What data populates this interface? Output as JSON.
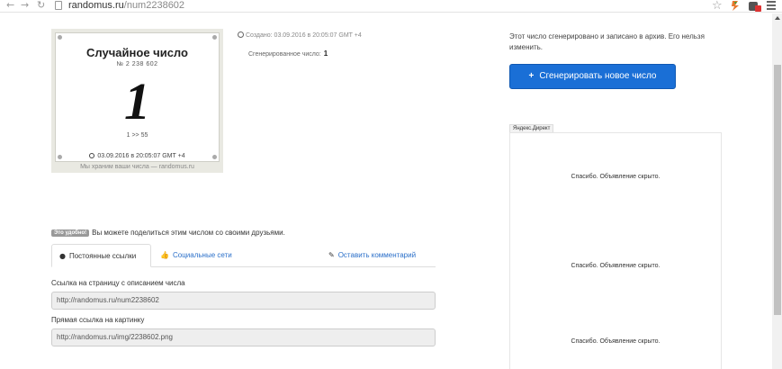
{
  "browser": {
    "url_host": "randomus.ru",
    "url_path": "/num2238602"
  },
  "card": {
    "title": "Случайное число",
    "number_line": "№ 2 238 602",
    "value": "1",
    "range": "1 >> 55",
    "date": "03.09.2016 в 20:05:07 GMT +4",
    "footer": "Мы храним ваши числа — randomus.ru"
  },
  "meta": {
    "created": "Создано: 03.09.2016 в 20:05:07 GMT +4",
    "generated_label": "Сгенерированное число:",
    "generated_value": "1"
  },
  "right": {
    "archive_note": "Этот число сгенерировано и записано в архив. Его нельзя изменить.",
    "generate_button": "Сгенерировать новое число",
    "ad_label": "Яндекс.Директ",
    "ad_texts": [
      "Спасибо. Объявление скрыто.",
      "Спасибо. Объявление скрыто.",
      "Спасибо. Объявление скрыто."
    ]
  },
  "share": {
    "badge": "Это удобно!",
    "text": "Вы можете поделиться этим числом со своими друзьями.",
    "tabs": [
      {
        "label": "Постоянные ссылки",
        "icon": "globe-icon"
      },
      {
        "label": "Социальные сети",
        "icon": "thumbs-up-icon"
      },
      {
        "label": "Оставить комментарий",
        "icon": "pencil-icon"
      }
    ],
    "fields": [
      {
        "label": "Ссылка на страницу с описанием числа",
        "value": "http://randomus.ru/num2238602"
      },
      {
        "label": "Прямая ссылка на картинку",
        "value": "http://randomus.ru/img/2238602.png"
      }
    ]
  },
  "colors": {
    "primary_button": "#1a6fd6",
    "link": "#2a6fc9"
  }
}
